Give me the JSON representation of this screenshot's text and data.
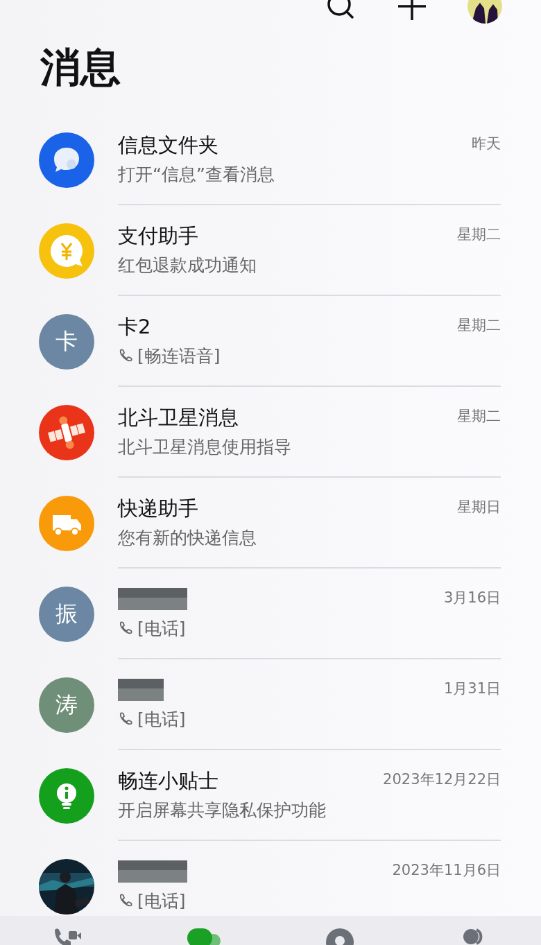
{
  "header": {
    "title": "消息"
  },
  "conversations": [
    {
      "avatar": {
        "kind": "chat"
      },
      "name": "信息文件夹",
      "preview": "打开“信息”查看消息",
      "time": "昨天",
      "call": false,
      "name_hidden": false
    },
    {
      "avatar": {
        "kind": "yuan"
      },
      "name": "支付助手",
      "preview": "红包退款成功通知",
      "time": "星期二",
      "call": false,
      "name_hidden": false
    },
    {
      "avatar": {
        "kind": "letter",
        "letter": "卡",
        "color": "#6b87a3"
      },
      "name": "卡2",
      "preview": "[畅连语音]",
      "time": "星期二",
      "call": true,
      "name_hidden": false
    },
    {
      "avatar": {
        "kind": "satellite"
      },
      "name": "北斗卫星消息",
      "preview": "北斗卫星消息使用指导",
      "time": "星期二",
      "call": false,
      "name_hidden": false
    },
    {
      "avatar": {
        "kind": "truck"
      },
      "name": "快递助手",
      "preview": "您有新的快递信息",
      "time": "星期日",
      "call": false,
      "name_hidden": false
    },
    {
      "avatar": {
        "kind": "letter",
        "letter": "振",
        "color": "#6b87a3"
      },
      "preview": "[电话]",
      "time": "3月16日",
      "call": true,
      "name_hidden": true
    },
    {
      "avatar": {
        "kind": "letter",
        "letter": "涛",
        "color": "#6f8f78"
      },
      "preview": "[电话]",
      "time": "1月31日",
      "call": true,
      "name_hidden": true
    },
    {
      "avatar": {
        "kind": "bulb"
      },
      "name": "畅连小贴士",
      "preview": "开启屏幕共享隐私保护功能",
      "time": "2023年12月22日",
      "call": false,
      "name_hidden": false
    },
    {
      "preview": "[电话]",
      "time": "2023年11月6日",
      "call": true,
      "name_hidden": true
    }
  ],
  "tabs": [
    {
      "kind": "calls",
      "selected": false
    },
    {
      "kind": "messages",
      "selected": true
    },
    {
      "kind": "discover",
      "selected": false
    },
    {
      "kind": "contacts",
      "selected": false
    }
  ]
}
